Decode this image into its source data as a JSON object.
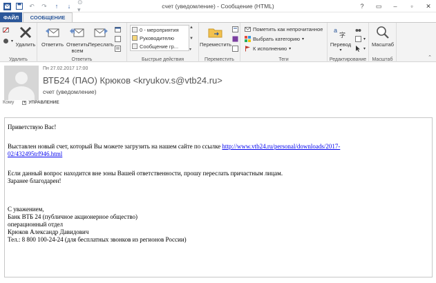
{
  "window": {
    "title": "счет (уведомление) - Сообщение (HTML)",
    "controls": [
      "?",
      "▭",
      "–",
      "▫",
      "✕"
    ]
  },
  "tabs": {
    "file": "ФАЙЛ",
    "message": "СООБЩЕНИЕ"
  },
  "ribbon": {
    "delete": {
      "label": "Удалить",
      "group": "Удалить"
    },
    "respond": {
      "reply": "Ответить",
      "reply_all_1": "Ответить",
      "reply_all_2": "всем",
      "forward": "Переслать",
      "group": "Ответить"
    },
    "quick_steps": {
      "items": [
        "0 - мероприятия",
        "Руководителю",
        "Сообщение гр..."
      ],
      "group": "Быстрые действия"
    },
    "move": {
      "label": "Переместить",
      "group": "Переместить"
    },
    "tags": {
      "unread": "Пометить как непрочитанное",
      "category": "Выбрать категорию",
      "followup": "К исполнению",
      "group": "Теги"
    },
    "editing": {
      "translate": "Перевод",
      "group": "Редактирование"
    },
    "zoom": {
      "label": "Масштаб",
      "group": "Масштаб"
    }
  },
  "header": {
    "date": "Пн 27.02.2017 17:00",
    "sender": "ВТБ24 (ПАО) Крюков <kryukov.s@vtb24.ru>",
    "subject": "счет (уведомление)",
    "to_label": "Кому",
    "manage_label": "УПРАВЛЕНИЕ"
  },
  "message": {
    "greeting": "Приветствую Вас!",
    "line1": "Выставлен новый счет, который Вы можете загрузить на нашем сайте по ссылке ",
    "link_part1": "http://www.vtb24.ru/personal/downloads/2017-",
    "link_part2": "02/432495trf946.html",
    "line2": "Если данный вопрос находится вне зоны Вашей ответственности, прошу переслать причастным лицам.",
    "line3": "Заранее благодарен!",
    "sig1": "С уважением,",
    "sig2": "Банк ВТБ 24 (публичное акционерное общество)",
    "sig3": "операционный отдел",
    "sig4": "Крюков Александр Давидович",
    "sig5": "Тел.: 8 800 100-24-24 (для бесплатных звонков из регионов России)"
  }
}
